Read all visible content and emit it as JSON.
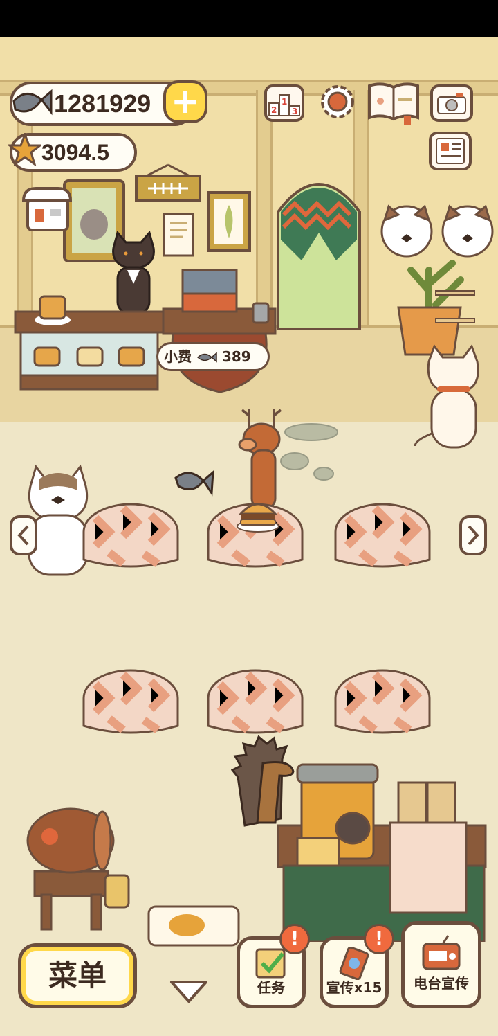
{
  "hud": {
    "fish_count": "1281929",
    "star_count": "3094.5",
    "plus_label": "+"
  },
  "tip": {
    "label": "小费",
    "value": "389"
  },
  "bottom": {
    "menu_label": "菜单",
    "tasks_label": "任务",
    "promo_label": "宣传x15",
    "radio_label": "电台宣传",
    "badge_text": "!"
  },
  "icons": {
    "fish": "fish-icon",
    "star": "star-icon",
    "leaderboard": "podium-icon",
    "settings": "gear-icon",
    "book": "paw-book-icon",
    "camera": "camera-icon",
    "news": "newspaper-icon",
    "shop": "shop-icon"
  },
  "colors": {
    "outline": "#6b4e3d",
    "accent_yellow": "#ffd84a",
    "badge_orange": "#f06a3e",
    "tablecloth": "#e8a080"
  }
}
